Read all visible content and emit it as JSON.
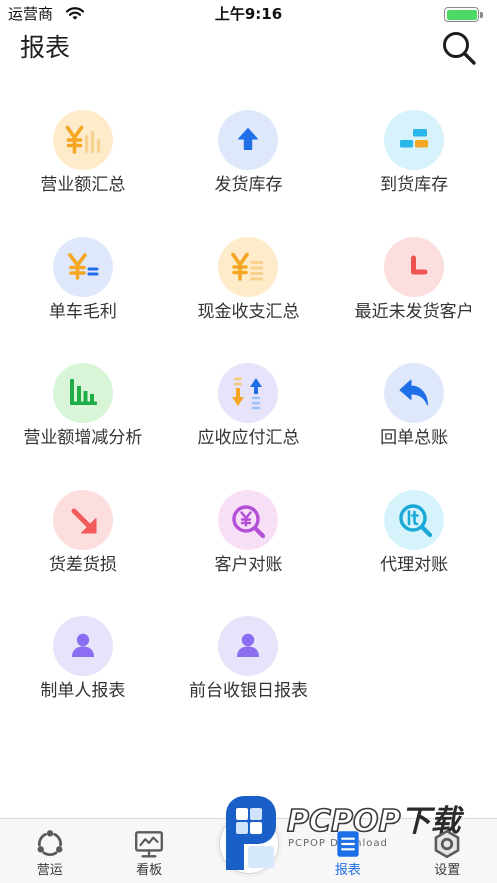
{
  "status_bar": {
    "carrier": "运营商",
    "time": "上午9:16",
    "battery_level": 1.0,
    "battery_color": "#4cd964"
  },
  "header": {
    "title": "报表"
  },
  "reports": [
    {
      "label": "营业额汇总",
      "icon": "yen-bar-chart-icon",
      "bg": "#fdebc9",
      "color": "#f5a623"
    },
    {
      "label": "发货库存",
      "icon": "arrow-up-icon",
      "bg": "#dfe8fb",
      "color": "#1f6fe8"
    },
    {
      "label": "到货库存",
      "icon": "stacked-boxes-icon",
      "bg": "#d6f3fb",
      "color": "#29b6e8"
    },
    {
      "label": "单车毛利",
      "icon": "yen-equals-icon",
      "bg": "#dfe8fb",
      "color": "#f5a623"
    },
    {
      "label": "现金收支汇总",
      "icon": "yen-list-icon",
      "bg": "#fdebc9",
      "color": "#f5a623"
    },
    {
      "label": "最近未发货客户",
      "icon": "clock-hands-icon",
      "bg": "#fcdede",
      "color": "#ef5350"
    },
    {
      "label": "营业额增减分析",
      "icon": "bar-chart-icon",
      "bg": "#d8f5d8",
      "color": "#1fae45"
    },
    {
      "label": "应收应付汇总",
      "icon": "up-down-arrows-icon",
      "bg": "#e6e3fb",
      "color": "#1f6fe8"
    },
    {
      "label": "回单总账",
      "icon": "reply-arrow-icon",
      "bg": "#dfe8fb",
      "color": "#1f6fe8"
    },
    {
      "label": "货差货损",
      "icon": "arrow-down-right-icon",
      "bg": "#fcdede",
      "color": "#f25b5b"
    },
    {
      "label": "客户对账",
      "icon": "yen-magnifier-icon",
      "bg": "#f7dff7",
      "color": "#b44fd8"
    },
    {
      "label": "代理对账",
      "icon": "lt-magnifier-icon",
      "bg": "#d6f3fb",
      "color": "#1aa9d6"
    },
    {
      "label": "制单人报表",
      "icon": "person-icon",
      "bg": "#e6e3fb",
      "color": "#8b6ef2"
    },
    {
      "label": "前台收银日报表",
      "icon": "person-icon",
      "bg": "#e6e3fb",
      "color": "#8b6ef2"
    }
  ],
  "tab_bar": {
    "active_color": "#1f6fe8",
    "items": [
      {
        "label": "营运",
        "icon": "operations-cycle-icon"
      },
      {
        "label": "看板",
        "icon": "dashboard-monitor-icon"
      },
      {
        "label": "报表",
        "icon": "report-document-icon",
        "active": true
      },
      {
        "label": "设置",
        "icon": "settings-hexagon-icon"
      }
    ],
    "center_button": {
      "icon": "center-action-icon"
    }
  },
  "watermark": {
    "brand": "PCPOP",
    "suffix": "下载",
    "tagline": "PCPOP Download"
  }
}
